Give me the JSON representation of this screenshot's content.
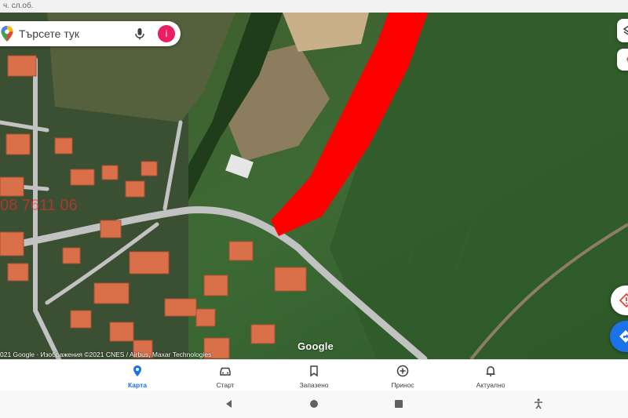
{
  "status_bar": {
    "text": "ч. сл.об."
  },
  "search": {
    "placeholder": "Търсете тук",
    "avatar_letter": "i"
  },
  "map": {
    "logo": "Google",
    "attribution": "021 Google · Изображения ©2021 CNES / Airbus, Maxar Technologies",
    "watermark": "08 7611 06",
    "colors": {
      "field": "#3f6b33",
      "field_dark": "#2e5528",
      "road": "#bdbdbd",
      "roof": "#d9704a",
      "highlight": "#ff0000"
    }
  },
  "bottom_nav": {
    "items": [
      {
        "label": "Карта",
        "icon": "location-pin-icon"
      },
      {
        "label": "Старт",
        "icon": "car-icon"
      },
      {
        "label": "Запазено",
        "icon": "bookmark-icon"
      },
      {
        "label": "Принос",
        "icon": "add-circle-icon"
      },
      {
        "label": "Актуално",
        "icon": "bell-icon"
      }
    ],
    "active": "Карта"
  },
  "system_nav": {
    "icons": [
      "back-icon",
      "home-icon",
      "recents-icon",
      "accessibility-icon"
    ]
  }
}
